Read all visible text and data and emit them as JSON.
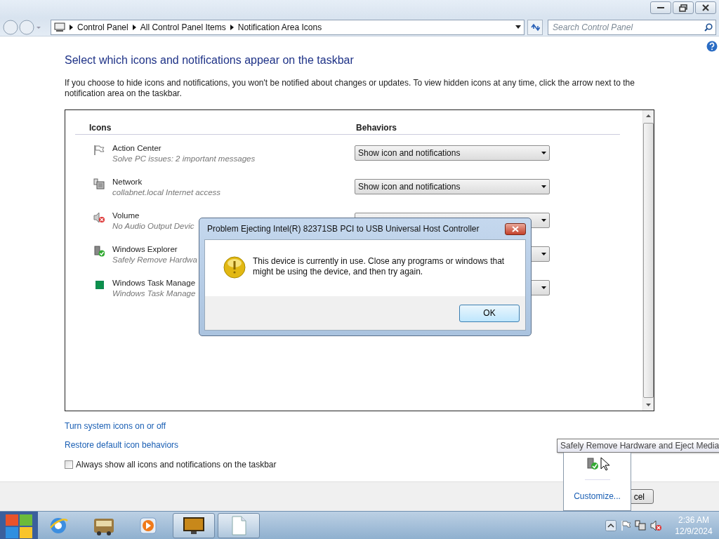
{
  "address_bar": {
    "breadcrumbs": [
      "Control Panel",
      "All Control Panel Items",
      "Notification Area Icons"
    ]
  },
  "search": {
    "placeholder": "Search Control Panel"
  },
  "heading": "Select which icons and notifications appear on the taskbar",
  "description": "If you choose to hide icons and notifications, you won't be notified about changes or updates. To view hidden icons at any time, click the arrow next to the notification area on the taskbar.",
  "icons_table": {
    "columns": [
      "Icons",
      "Behaviors"
    ],
    "rows": [
      {
        "kind": "flag",
        "name": "Action Center",
        "detail": "Solve PC issues: 2 important messages",
        "behavior": "Show icon and notifications"
      },
      {
        "kind": "network",
        "name": "Network",
        "detail": "collabnet.local Internet access",
        "behavior": "Show icon and notifications"
      },
      {
        "kind": "volume",
        "name": "Volume",
        "detail": "No Audio Output Devic"
      },
      {
        "kind": "usb",
        "name": "Windows Explorer",
        "detail": "Safely Remove Hardwa"
      },
      {
        "kind": "taskmgr",
        "name": "Windows Task Manage",
        "detail": "Windows Task Manage"
      }
    ]
  },
  "links": [
    "Turn system icons on or off",
    "Restore default icon behaviors"
  ],
  "always_show": {
    "label": "Always show all icons and notifications on the taskbar",
    "checked": false
  },
  "bottom_buttons": [
    "cel"
  ],
  "dialog": {
    "title": "Problem Ejecting Intel(R) 82371SB PCI to USB Universal Host Controller",
    "message": "This device is currently in use. Close any programs or windows that might be using the device, and then try again.",
    "button": "OK"
  },
  "tooltip": "Safely Remove Hardware and Eject Media",
  "tray_popup": {
    "link": "Customize..."
  },
  "taskbar": {
    "apps": [
      {
        "kind": "browser",
        "running": false
      },
      {
        "kind": "bus",
        "running": false
      },
      {
        "kind": "media",
        "running": false
      },
      {
        "kind": "monitor",
        "running": true
      },
      {
        "kind": "document",
        "running": true
      }
    ]
  },
  "clock": {
    "time": "2:36 AM",
    "date": "12/9/2024"
  }
}
